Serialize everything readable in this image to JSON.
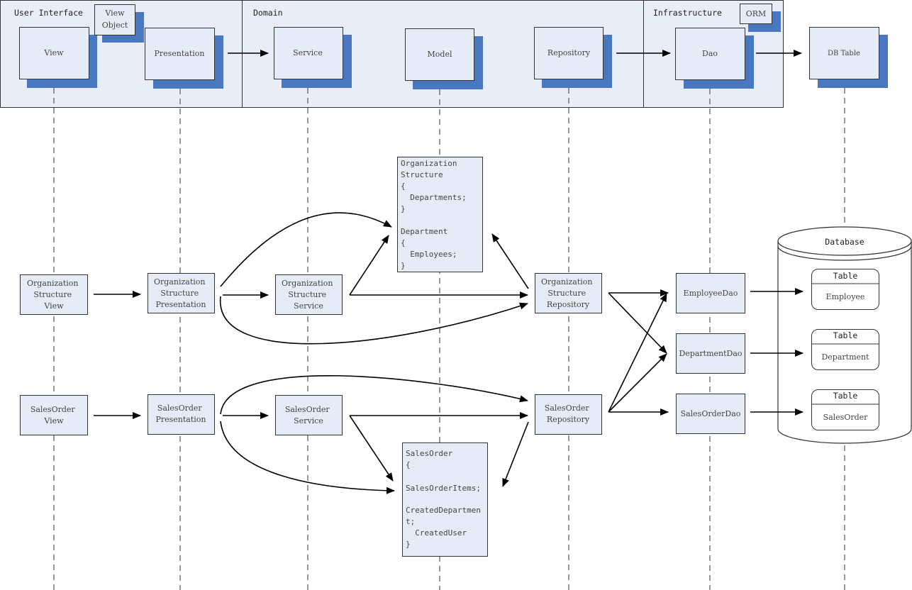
{
  "layers": [
    {
      "id": "ui",
      "title": "User Interface"
    },
    {
      "id": "domain",
      "title": "Domain"
    },
    {
      "id": "infra",
      "title": "Infrastructure"
    }
  ],
  "lifelines": [
    {
      "id": "view",
      "label": "View"
    },
    {
      "id": "presentation",
      "label": "Presentation"
    },
    {
      "id": "service",
      "label": "Service"
    },
    {
      "id": "model",
      "label": "Model"
    },
    {
      "id": "repository",
      "label": "Repository"
    },
    {
      "id": "dao",
      "label": "Dao"
    },
    {
      "id": "dbtable",
      "label": "DB Table"
    }
  ],
  "notes": {
    "view_object": [
      "View",
      "Object"
    ],
    "orm": "ORM"
  },
  "org_row": {
    "view": [
      "Organization",
      "Structure",
      "View"
    ],
    "presentation": [
      "Organization",
      "Structure",
      "Presentation"
    ],
    "service": [
      "Organization",
      "Structure",
      "Service"
    ],
    "repository": [
      "Organization",
      "Structure",
      "Repository"
    ]
  },
  "sales_row": {
    "view": [
      "SalesOrder",
      "View"
    ],
    "presentation": [
      "SalesOrder",
      "Presentation"
    ],
    "service": [
      "SalesOrder",
      "Service"
    ],
    "repository": [
      "SalesOrder",
      "Repository"
    ]
  },
  "daos": [
    "EmployeeDao",
    "DepartmentDao",
    "SalesOrderDao"
  ],
  "org_model_code": [
    "Organization",
    "Structure",
    "{",
    "  Departments;",
    "}",
    "",
    "Department",
    "{",
    "  Employees;",
    "}"
  ],
  "sales_model_code": [
    "SalesOrder",
    "{",
    "",
    "SalesOrderItems;",
    "",
    "CreatedDepartmen",
    "t;",
    "  CreatedUser",
    "}"
  ],
  "database": {
    "title": "Database",
    "tables": [
      {
        "header": "Table",
        "name": "Employee"
      },
      {
        "header": "Table",
        "name": "Department"
      },
      {
        "header": "Table",
        "name": "SalesOrder"
      }
    ]
  },
  "colors": {
    "layer_fill": "#e8edf8",
    "box_fill": "#e6ecf7",
    "shadow": "#4a78c0",
    "stroke": "#333333"
  }
}
